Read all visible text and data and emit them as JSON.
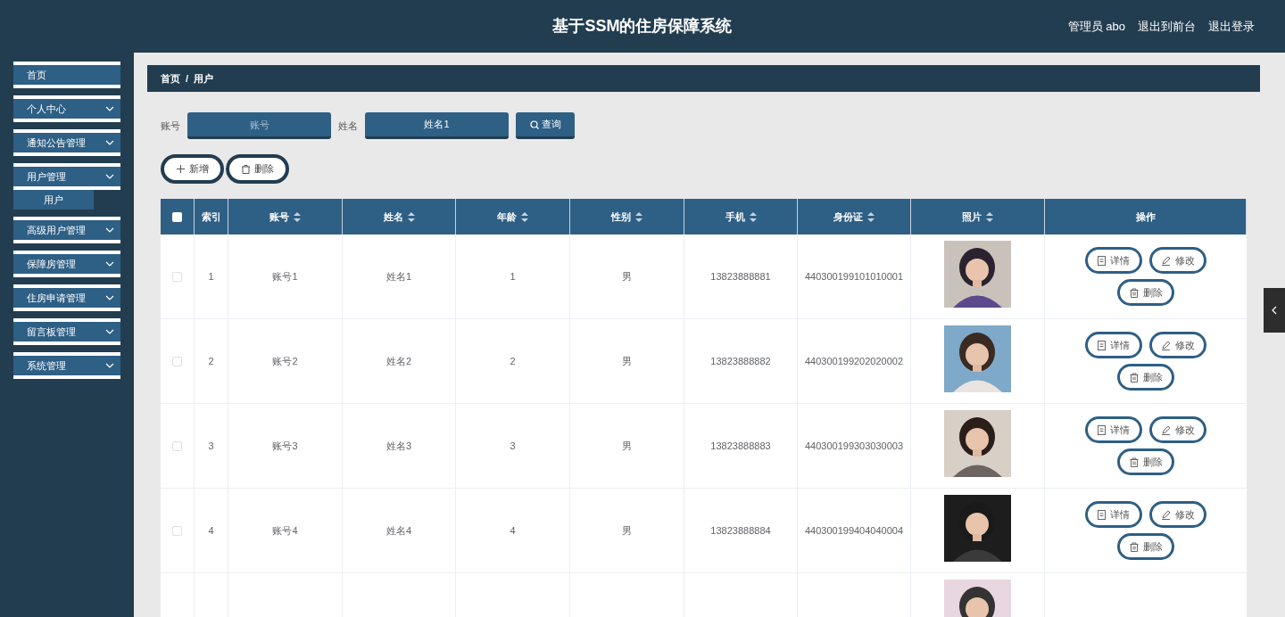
{
  "header": {
    "title": "基于SSM的住房保障系统",
    "links": [
      "管理员 abo",
      "退出到前台",
      "退出登录"
    ]
  },
  "sidebar": {
    "items": [
      {
        "label": "首页",
        "expandable": false
      },
      {
        "label": "个人中心",
        "expandable": true
      },
      {
        "label": "通知公告管理",
        "expandable": true
      },
      {
        "label": "用户管理",
        "expandable": true,
        "children": [
          {
            "label": "用户"
          }
        ]
      },
      {
        "label": "高级用户管理",
        "expandable": true
      },
      {
        "label": "保障房管理",
        "expandable": true
      },
      {
        "label": "住房申请管理",
        "expandable": true
      },
      {
        "label": "留言板管理",
        "expandable": true
      },
      {
        "label": "系统管理",
        "expandable": true
      }
    ]
  },
  "breadcrumb": [
    "首页",
    "/",
    "用户"
  ],
  "search": {
    "fields": [
      {
        "label": "账号",
        "placeholder": "账号"
      },
      {
        "label": "姓名",
        "value": "姓名1"
      }
    ],
    "button": "查询"
  },
  "actions": [
    {
      "kind": "add",
      "label": "新增"
    },
    {
      "kind": "delete",
      "label": "删除"
    }
  ],
  "table": {
    "select_all_checked": false,
    "columns": [
      {
        "label": "索引",
        "sortable": false
      },
      {
        "label": "账号",
        "sortable": true
      },
      {
        "label": "姓名",
        "sortable": true
      },
      {
        "label": "年龄",
        "sortable": true
      },
      {
        "label": "性别",
        "sortable": true
      },
      {
        "label": "手机",
        "sortable": true
      },
      {
        "label": "身份证",
        "sortable": true
      },
      {
        "label": "照片",
        "sortable": true
      },
      {
        "label": "操作",
        "sortable": false
      }
    ],
    "rows": [
      {
        "checked": false,
        "cells": [
          "1",
          "账号1",
          "姓名1",
          "1",
          "男",
          "13823888881",
          "440300199101010001"
        ],
        "photo": {
          "kind": "picture"
        },
        "buttons": [
          "详情",
          "修改",
          "删除"
        ]
      },
      {
        "checked": false,
        "cells": [
          "2",
          "账号2",
          "姓名2",
          "2",
          "男",
          "13823888882",
          "440300199202020002"
        ],
        "photo": {
          "kind": "picture"
        },
        "buttons": [
          "详情",
          "修改",
          "删除"
        ]
      },
      {
        "checked": false,
        "cells": [
          "3",
          "账号3",
          "姓名3",
          "3",
          "男",
          "13823888883",
          "440300199303030003"
        ],
        "photo": {
          "kind": "picture"
        },
        "buttons": [
          "详情",
          "修改",
          "删除"
        ]
      },
      {
        "checked": false,
        "cells": [
          "4",
          "账号4",
          "姓名4",
          "4",
          "男",
          "13823888884",
          "440300199404040004"
        ],
        "photo": {
          "kind": "picture"
        },
        "buttons": [
          "详情",
          "修改",
          "删除"
        ]
      },
      {
        "cells": [],
        "photo": {
          "kind": "picture"
        },
        "buttons": []
      }
    ]
  }
}
